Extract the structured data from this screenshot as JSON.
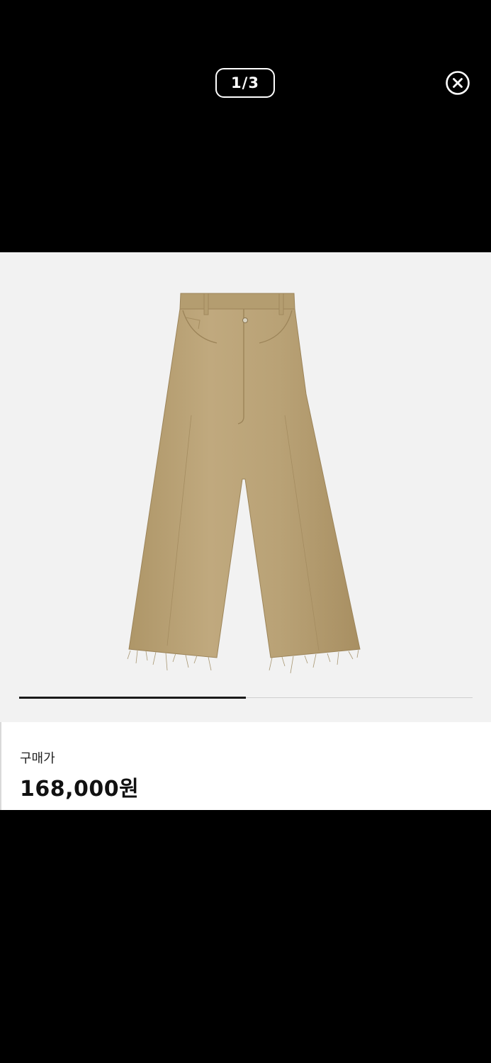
{
  "viewer": {
    "page_indicator": "1/3",
    "current_page": 1,
    "total_pages": 3,
    "close_icon": "close-circle-icon"
  },
  "gallery": {
    "image_subject": "beige-wide-leg-pants",
    "progress_fraction": 0.5
  },
  "product": {
    "price_label": "구매가",
    "price": "168,000원"
  },
  "colors": {
    "overlay_background": "#000000",
    "image_background": "#f2f2f2",
    "pants": "#bba47a",
    "progress_active": "#1a1a1a",
    "progress_track": "#cfcfcf"
  }
}
